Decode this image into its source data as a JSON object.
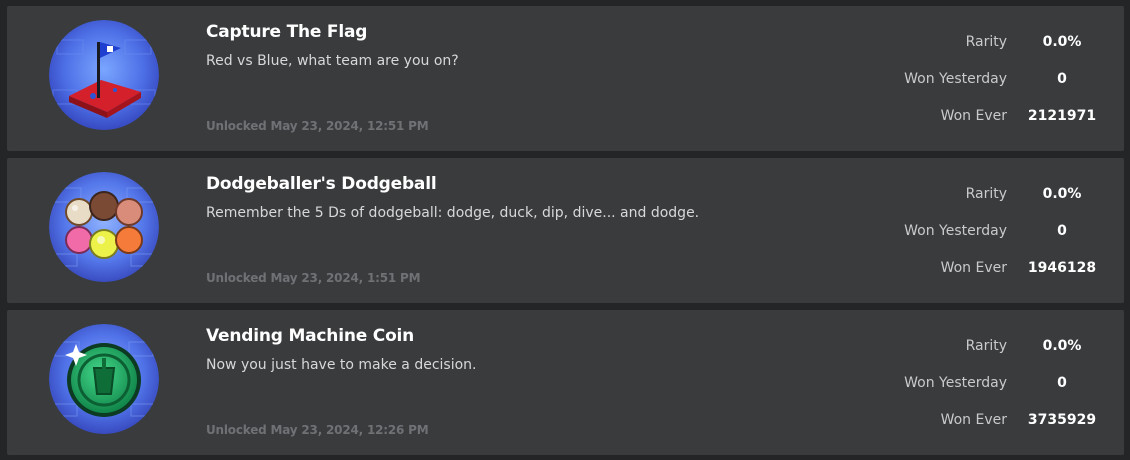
{
  "badges": [
    {
      "title": "Capture The Flag",
      "description": "Red vs Blue, what team are you on?",
      "unlocked": "Unlocked May 23, 2024, 12:51 PM",
      "icon": "flag-icon",
      "stats": {
        "rarity_label": "Rarity",
        "rarity_value": "0.0%",
        "won_yesterday_label": "Won Yesterday",
        "won_yesterday_value": "0",
        "won_ever_label": "Won Ever",
        "won_ever_value": "2121971"
      }
    },
    {
      "title": "Dodgeballer's Dodgeball",
      "description": "Remember the 5 Ds of dodgeball: dodge, duck, dip, dive... and dodge.",
      "unlocked": "Unlocked May 23, 2024, 1:51 PM",
      "icon": "dodgeballs-icon",
      "stats": {
        "rarity_label": "Rarity",
        "rarity_value": "0.0%",
        "won_yesterday_label": "Won Yesterday",
        "won_yesterday_value": "0",
        "won_ever_label": "Won Ever",
        "won_ever_value": "1946128"
      }
    },
    {
      "title": "Vending Machine Coin",
      "description": "Now you just have to make a decision.",
      "unlocked": "Unlocked May 23, 2024, 12:26 PM",
      "icon": "vending-coin-icon",
      "stats": {
        "rarity_label": "Rarity",
        "rarity_value": "0.0%",
        "won_yesterday_label": "Won Yesterday",
        "won_yesterday_value": "0",
        "won_ever_label": "Won Ever",
        "won_ever_value": "3735929"
      }
    }
  ],
  "colors": {
    "page_bg": "#232527",
    "card_bg": "#393b3d",
    "title": "#ffffff",
    "description": "#d7d8d9",
    "unlocked": "#6f7174",
    "coin_green": "#1fae5b"
  }
}
